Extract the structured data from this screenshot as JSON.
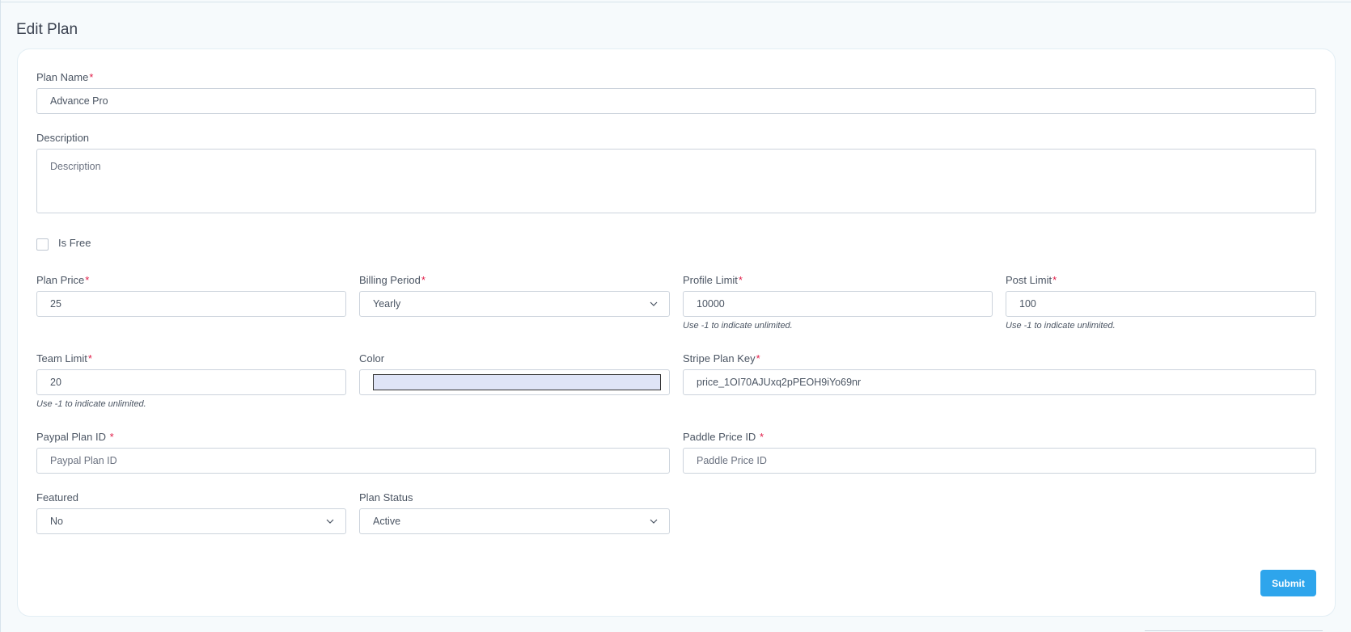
{
  "page": {
    "title": "Edit Plan"
  },
  "form": {
    "plan_name": {
      "label": "Plan Name",
      "required_mark": "*",
      "value": "Advance Pro"
    },
    "description": {
      "label": "Description",
      "placeholder": "Description"
    },
    "is_free": {
      "label": "Is Free",
      "checked": false
    },
    "plan_price": {
      "label": "Plan Price",
      "required_mark": "*",
      "value": "25"
    },
    "billing_period": {
      "label": "Billing Period",
      "required_mark": "*",
      "value": "Yearly"
    },
    "profile_limit": {
      "label": "Profile Limit",
      "required_mark": "*",
      "value": "10000",
      "hint": "Use -1 to indicate unlimited."
    },
    "post_limit": {
      "label": "Post Limit",
      "required_mark": "*",
      "value": "100",
      "hint": "Use -1 to indicate unlimited."
    },
    "team_limit": {
      "label": "Team Limit",
      "required_mark": "*",
      "value": "20",
      "hint": "Use -1 to indicate unlimited."
    },
    "color": {
      "label": "Color",
      "value": "#dfe4f7"
    },
    "stripe_plan_key": {
      "label": "Stripe Plan Key",
      "required_mark": "*",
      "value": "price_1OI70AJUxq2pPEOH9iYo69nr"
    },
    "paypal_plan_id": {
      "label": "Paypal Plan ID ",
      "required_mark": "*",
      "placeholder": "Paypal Plan ID"
    },
    "paddle_price_id": {
      "label": "Paddle Price ID ",
      "required_mark": "*",
      "placeholder": "Paddle Price ID"
    },
    "featured": {
      "label": "Featured",
      "value": "No"
    },
    "plan_status": {
      "label": "Plan Status",
      "value": "Active"
    },
    "submit_label": "Submit"
  },
  "colors": {
    "accent": "#2ea5ec",
    "required": "#e11d48"
  },
  "icons": {
    "select_arrow": "chevron-down-icon"
  }
}
